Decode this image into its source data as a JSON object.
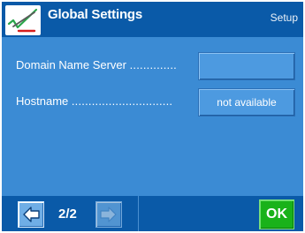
{
  "header": {
    "title": "Global Settings",
    "section": "Setup"
  },
  "settings": [
    {
      "label": "Domain Name Server",
      "dots": "..............",
      "value": ""
    },
    {
      "label": "Hostname",
      "dots": "..............................",
      "value": "not available"
    }
  ],
  "footer": {
    "page": "2/2",
    "ok_label": "OK",
    "prev_icon": "arrow-left-icon",
    "next_icon": "arrow-right-icon"
  },
  "colors": {
    "header": "#0a5aa8",
    "body": "#3b8bd4",
    "ok": "#19b21a"
  }
}
